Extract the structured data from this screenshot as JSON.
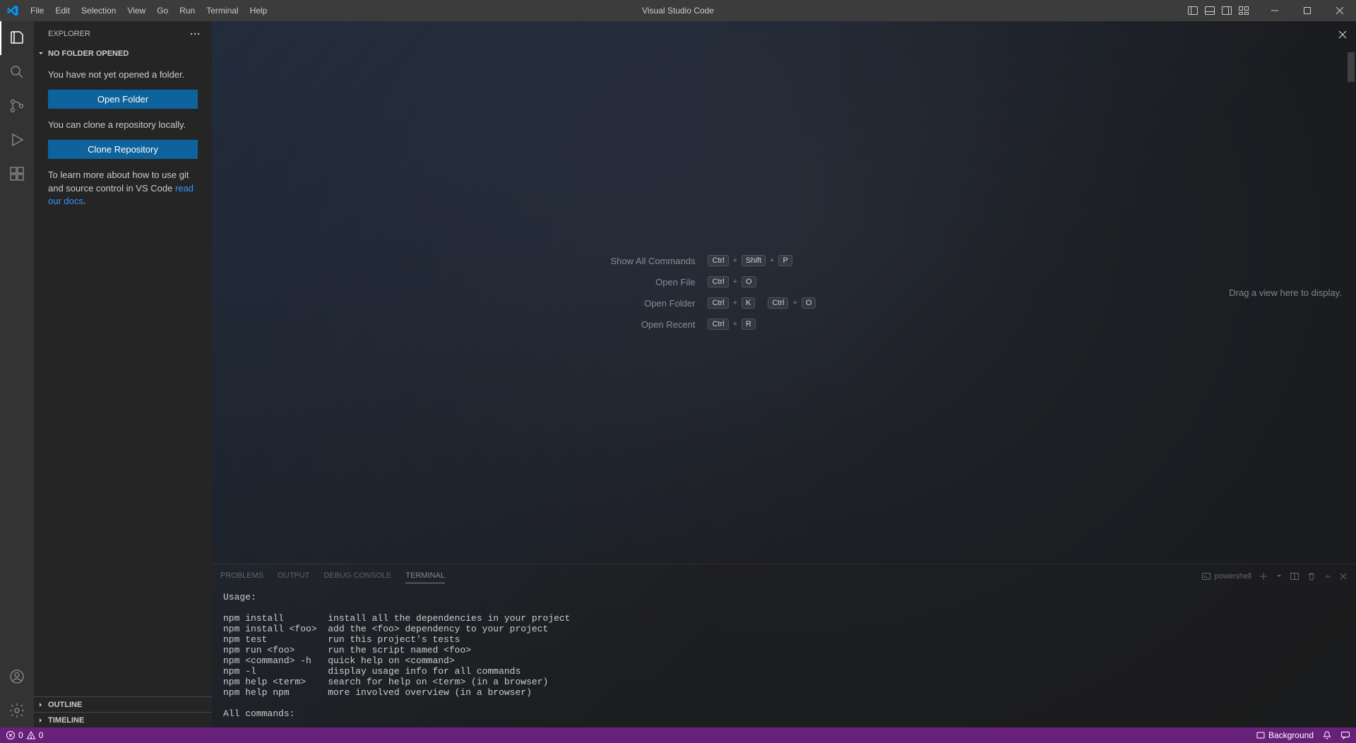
{
  "title": "Visual Studio Code",
  "menubar": [
    "File",
    "Edit",
    "Selection",
    "View",
    "Go",
    "Run",
    "Terminal",
    "Help"
  ],
  "sidebar": {
    "title": "EXPLORER",
    "section_title": "NO FOLDER OPENED",
    "msg1": "You have not yet opened a folder.",
    "btn_open": "Open Folder",
    "msg2": "You can clone a repository locally.",
    "btn_clone": "Clone Repository",
    "msg3a": "To learn more about how to use git and source control in VS Code ",
    "link": "read our docs",
    "msg3b": ".",
    "outline": "OUTLINE",
    "timeline": "TIMELINE"
  },
  "watermark": {
    "rows": [
      {
        "label": "Show All Commands",
        "keys": [
          "Ctrl",
          "Shift",
          "P"
        ]
      },
      {
        "label": "Open File",
        "keys": [
          "Ctrl",
          "O"
        ]
      },
      {
        "label": "Open Folder",
        "keys": [
          "Ctrl",
          "K"
        ],
        "keys2": [
          "Ctrl",
          "O"
        ]
      },
      {
        "label": "Open Recent",
        "keys": [
          "Ctrl",
          "R"
        ]
      }
    ]
  },
  "drop_hint": "Drag a view here to display.",
  "panel": {
    "tabs": [
      "PROBLEMS",
      "OUTPUT",
      "DEBUG CONSOLE",
      "TERMINAL"
    ],
    "active_tab": 3,
    "terminal_name": "powershell",
    "content": "Usage:\n\nnpm install        install all the dependencies in your project\nnpm install <foo>  add the <foo> dependency to your project\nnpm test           run this project's tests\nnpm run <foo>      run the script named <foo>\nnpm <command> -h   quick help on <command>\nnpm -l             display usage info for all commands\nnpm help <term>    search for help on <term> (in a browser)\nnpm help npm       more involved overview (in a browser)\n\nAll commands:"
  },
  "status": {
    "errors": "0",
    "warnings": "0",
    "background": "Background"
  }
}
